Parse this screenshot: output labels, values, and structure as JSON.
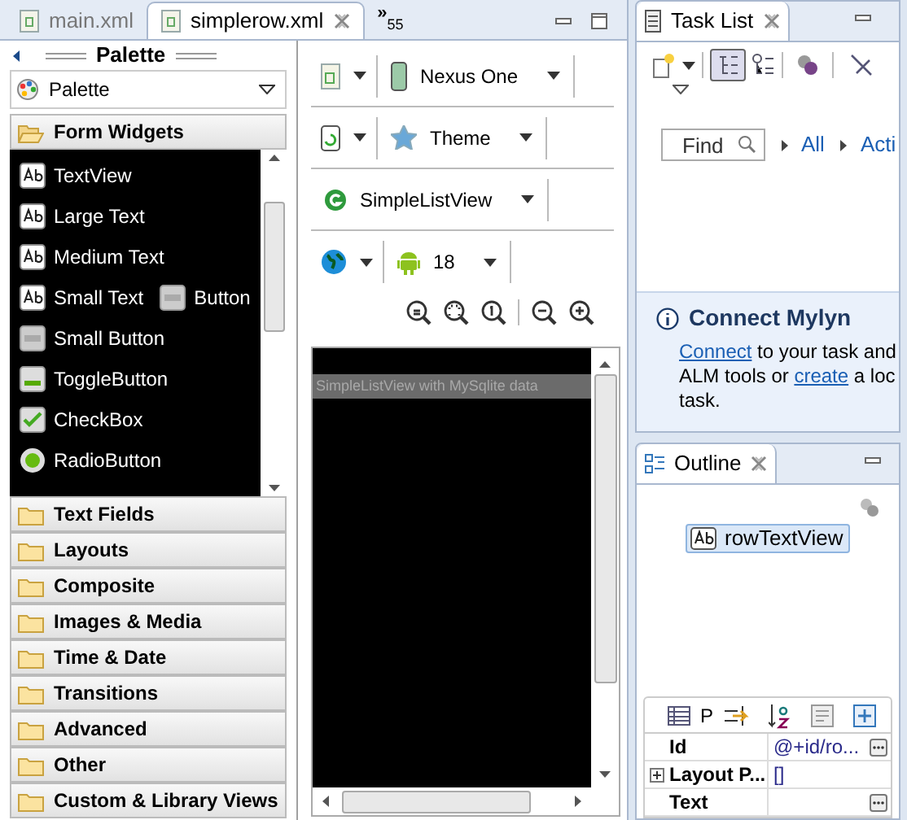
{
  "editor_tabs": [
    {
      "label": "main.xml",
      "selected": false
    },
    {
      "label": "simplerow.xml",
      "selected": true
    }
  ],
  "tab_overflow": {
    "glyph": "»",
    "count": "55"
  },
  "palette": {
    "title": "Palette",
    "dropdown": "Palette",
    "open_category": "Form Widgets",
    "widget_rows": [
      [
        {
          "kind": "ab",
          "label": "TextView"
        }
      ],
      [
        {
          "kind": "ab",
          "label": "Large Text"
        }
      ],
      [
        {
          "kind": "ab",
          "label": "Medium Text"
        }
      ],
      [
        {
          "kind": "ab",
          "label": "Small Text"
        },
        {
          "kind": "ok",
          "label": "Button"
        }
      ],
      [
        {
          "kind": "ok",
          "label": "Small Button"
        }
      ],
      [
        {
          "kind": "toggle",
          "label": "ToggleButton"
        }
      ],
      [
        {
          "kind": "check",
          "label": "CheckBox"
        }
      ],
      [
        {
          "kind": "radio",
          "label": "RadioButton"
        }
      ]
    ],
    "categories": [
      "Text Fields",
      "Layouts",
      "Composite",
      "Images & Media",
      "Time & Date",
      "Transitions",
      "Advanced",
      "Other",
      "Custom & Library Views"
    ]
  },
  "layout_toolbar": [
    [
      {
        "kind": "doc"
      },
      {
        "kind": "device",
        "label": "Nexus One"
      }
    ],
    [
      {
        "kind": "rotate"
      },
      {
        "kind": "theme",
        "label": "Theme"
      }
    ],
    [
      {
        "kind": "activity",
        "label": "SimpleListView"
      }
    ],
    [
      {
        "kind": "globe"
      },
      {
        "kind": "android",
        "label": "18"
      }
    ]
  ],
  "preview": {
    "title_bar": "SimpleListView with MySqlite data"
  },
  "task_list": {
    "tab": "Task List",
    "find_placeholder": "Find",
    "filters": [
      "All",
      "Acti"
    ],
    "connect": {
      "heading": "Connect Mylyn",
      "text": [
        {
          "text": "Connect",
          "link": true
        },
        {
          "text": " to your task and ALM tools or ",
          "link": false
        },
        {
          "text": "create",
          "link": true
        },
        {
          "text": " a loc task.",
          "link": false
        }
      ]
    }
  },
  "outline": {
    "tab": "Outline",
    "items": [
      {
        "label": "rowTextView",
        "selected": true
      }
    ]
  },
  "properties": {
    "toolbar_label": "P",
    "rows": [
      {
        "name": "Id",
        "value": "@+id/ro...",
        "expandable": false,
        "has_button": true
      },
      {
        "name": "Layout P...",
        "value": "[]",
        "expandable": true,
        "has_button": false
      },
      {
        "name": "Text",
        "value": "",
        "expandable": false,
        "has_button": true
      }
    ]
  }
}
